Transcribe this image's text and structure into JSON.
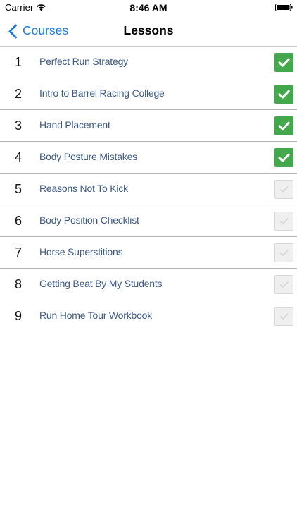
{
  "status_bar": {
    "carrier": "Carrier",
    "time": "8:46 AM",
    "wifi_icon": "wifi-icon",
    "battery_icon": "battery-full-icon"
  },
  "nav": {
    "back_label": "Courses",
    "back_icon": "chevron-left-icon",
    "title": "Lessons",
    "accent_color": "#1a7bd6"
  },
  "colors": {
    "complete": "#43a84b",
    "incomplete": "#efefef",
    "lesson_title": "#3d5a86"
  },
  "lessons": [
    {
      "number": "1",
      "title": "Perfect Run Strategy",
      "completed": true
    },
    {
      "number": "2",
      "title": "Intro to Barrel Racing College",
      "completed": true
    },
    {
      "number": "3",
      "title": "Hand Placement",
      "completed": true
    },
    {
      "number": "4",
      "title": "Body Posture Mistakes",
      "completed": true
    },
    {
      "number": "5",
      "title": "Reasons Not To Kick",
      "completed": false
    },
    {
      "number": "6",
      "title": "Body Position Checklist",
      "completed": false
    },
    {
      "number": "7",
      "title": "Horse Superstitions",
      "completed": false
    },
    {
      "number": "8",
      "title": "Getting Beat By My Students",
      "completed": false
    },
    {
      "number": "9",
      "title": "Run Home Tour Workbook",
      "completed": false
    }
  ]
}
